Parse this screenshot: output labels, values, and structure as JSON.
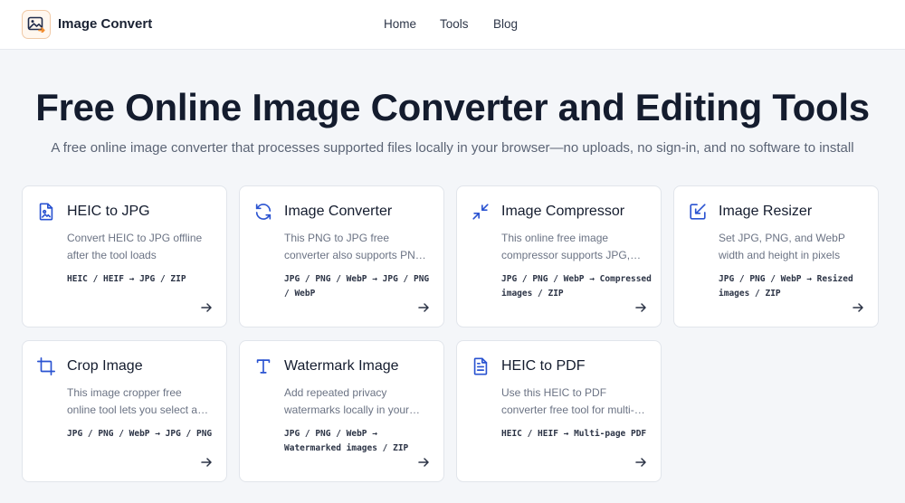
{
  "header": {
    "brand": "Image Convert",
    "nav": [
      {
        "label": "Home"
      },
      {
        "label": "Tools"
      },
      {
        "label": "Blog"
      }
    ]
  },
  "hero": {
    "title": "Free Online Image Converter and Editing Tools",
    "subtitle": "A free online image converter that processes supported files locally in your browser—no uploads, no sign-in, and no software to install"
  },
  "colors": {
    "accent": "#2a53d1",
    "logo_accent": "#f08a2c",
    "background": "#f4f6f9"
  },
  "cards": [
    {
      "title": "HEIC to JPG",
      "icon": "image-file-icon",
      "desc": "Convert HEIC to JPG offline after the tool loads",
      "formats": "HEIC / HEIF → JPG / ZIP"
    },
    {
      "title": "Image Converter",
      "icon": "refresh-icon",
      "desc": "This PNG to JPG free converter also supports PNG, WebP and more",
      "formats": "JPG / PNG / WebP → JPG / PNG / WebP"
    },
    {
      "title": "Image Compressor",
      "icon": "compress-icon",
      "desc": "This online free image compressor supports JPG, PNG and WebP",
      "formats": "JPG / PNG / WebP → Compressed images / ZIP"
    },
    {
      "title": "Image Resizer",
      "icon": "resize-icon",
      "desc": "Set JPG, PNG, and WebP width and height in pixels",
      "formats": "JPG / PNG / WebP → Resized images / ZIP"
    },
    {
      "title": "Crop Image",
      "icon": "crop-icon",
      "desc": "This image cropper free online tool lets you select an area",
      "formats": "JPG / PNG / WebP → JPG / PNG"
    },
    {
      "title": "Watermark Image",
      "icon": "text-icon",
      "desc": "Add repeated privacy watermarks locally in your browser",
      "formats": "JPG / PNG / WebP → Watermarked images / ZIP"
    },
    {
      "title": "HEIC to PDF",
      "icon": "document-icon",
      "desc": "Use this HEIC to PDF converter free tool for multi-page PDFs",
      "formats": "HEIC / HEIF → Multi-page PDF"
    }
  ]
}
